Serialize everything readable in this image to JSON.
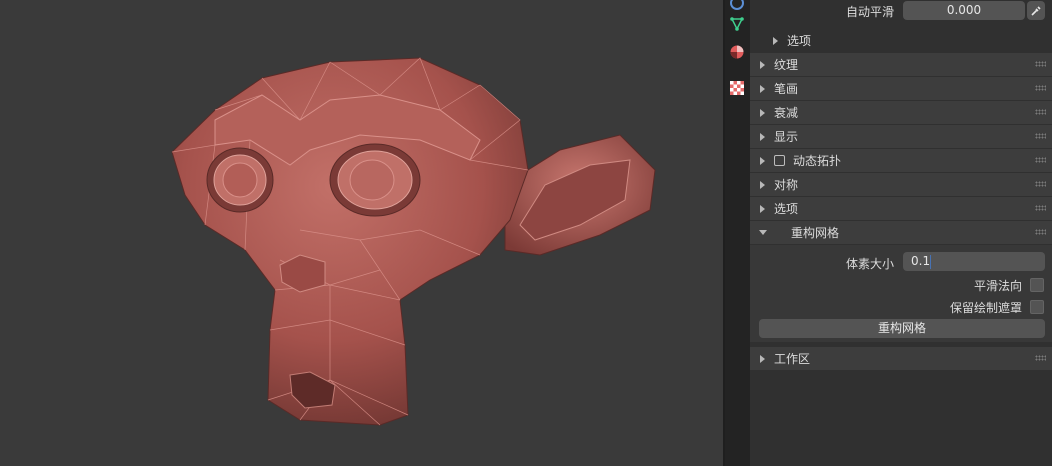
{
  "viewport": {
    "subject": "monkey-head-mesh"
  },
  "tabs": [
    {
      "icon": "object-data-icon",
      "active": false
    },
    {
      "icon": "mesh-data-icon",
      "active": false
    },
    {
      "icon": "material-icon",
      "active": false
    },
    {
      "icon": "texture-icon",
      "active": false
    }
  ],
  "top_field": {
    "label": "自动平滑",
    "value": "0.000"
  },
  "options_sub": {
    "label": "选项"
  },
  "panels": {
    "texture": "纹理",
    "stroke": "笔画",
    "falloff": "衰减",
    "display": "显示",
    "dyntopo": "动态拓扑",
    "symmetry": "对称",
    "options": "选项",
    "remesh": "重构网格",
    "workspace": "工作区"
  },
  "remesh": {
    "voxel_size_label": "体素大小",
    "voxel_size_value": "0.1",
    "smooth_normals_label": "平滑法向",
    "preserve_mask_label": "保留绘制遮罩",
    "button_label": "重构网格"
  },
  "colors": {
    "accent": "#4772b3",
    "mesh": "#a9554f",
    "panel_bg": "#303030",
    "header_bg": "#3d3d3d"
  }
}
